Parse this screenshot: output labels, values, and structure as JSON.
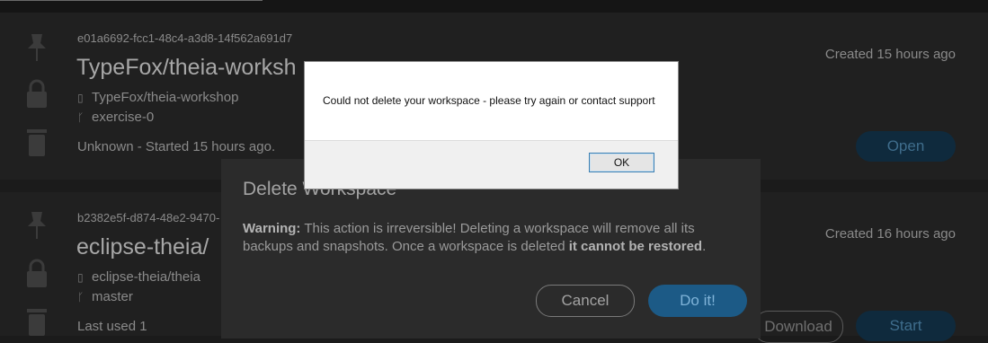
{
  "workspaces": [
    {
      "id": "e01a6692-fcc1-48c4-a3d8-14f562a691d7",
      "title": "TypeFox/theia-worksh",
      "repo": "TypeFox/theia-workshop",
      "branch": "exercise-0",
      "status": "Unknown - Started 15 hours ago.",
      "created": "Created 15 hours ago",
      "action": "Open"
    },
    {
      "id": "b2382e5f-d874-48e2-9470-",
      "title": "eclipse-theia/",
      "repo": "eclipse-theia/theia",
      "branch": "master",
      "status": "Last used 1",
      "created": "Created 16 hours ago",
      "action": "Start",
      "secondary_action": "Download"
    }
  ],
  "delete_modal": {
    "title": "Delete Workspace",
    "warning_label": "Warning:",
    "warning_text": " This action is irreversible! Deleting a workspace will remove all its backups and snapshots. Once a workspace is deleted ",
    "warning_emphasis": "it cannot be restored",
    "warning_end": ".",
    "cancel_label": "Cancel",
    "confirm_label": "Do it!"
  },
  "alert": {
    "message": "Could not delete your workspace - please try again or contact support",
    "ok_label": "OK"
  },
  "icons": {
    "pin": "pin-icon",
    "lock": "lock-icon",
    "trash": "trash-icon",
    "repo": "repo-icon",
    "branch": "branch-icon"
  }
}
